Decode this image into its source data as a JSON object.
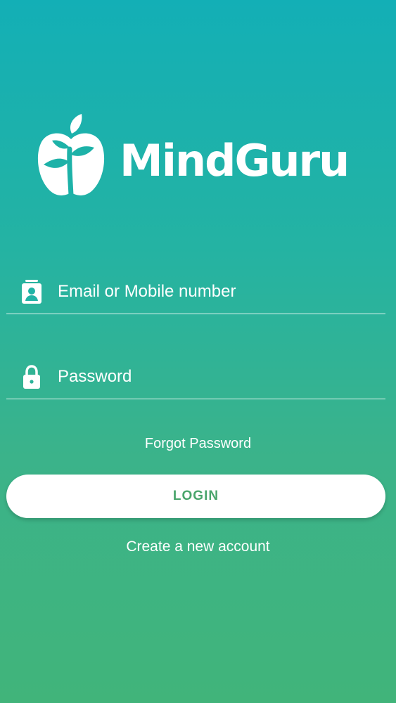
{
  "brand": {
    "name": "MindGuru"
  },
  "form": {
    "email_placeholder": "Email or Mobile number",
    "password_placeholder": "Password",
    "forgot_password_label": "Forgot Password",
    "login_label": "LOGIN",
    "create_account_label": "Create a new account"
  },
  "icons": {
    "logo": "apple-sprout-icon",
    "email": "contact-card-icon",
    "password": "lock-icon"
  },
  "colors": {
    "gradient_top": "#13afb6",
    "gradient_bottom": "#41b47a",
    "login_text": "#4aa56c",
    "foreground": "#ffffff"
  }
}
